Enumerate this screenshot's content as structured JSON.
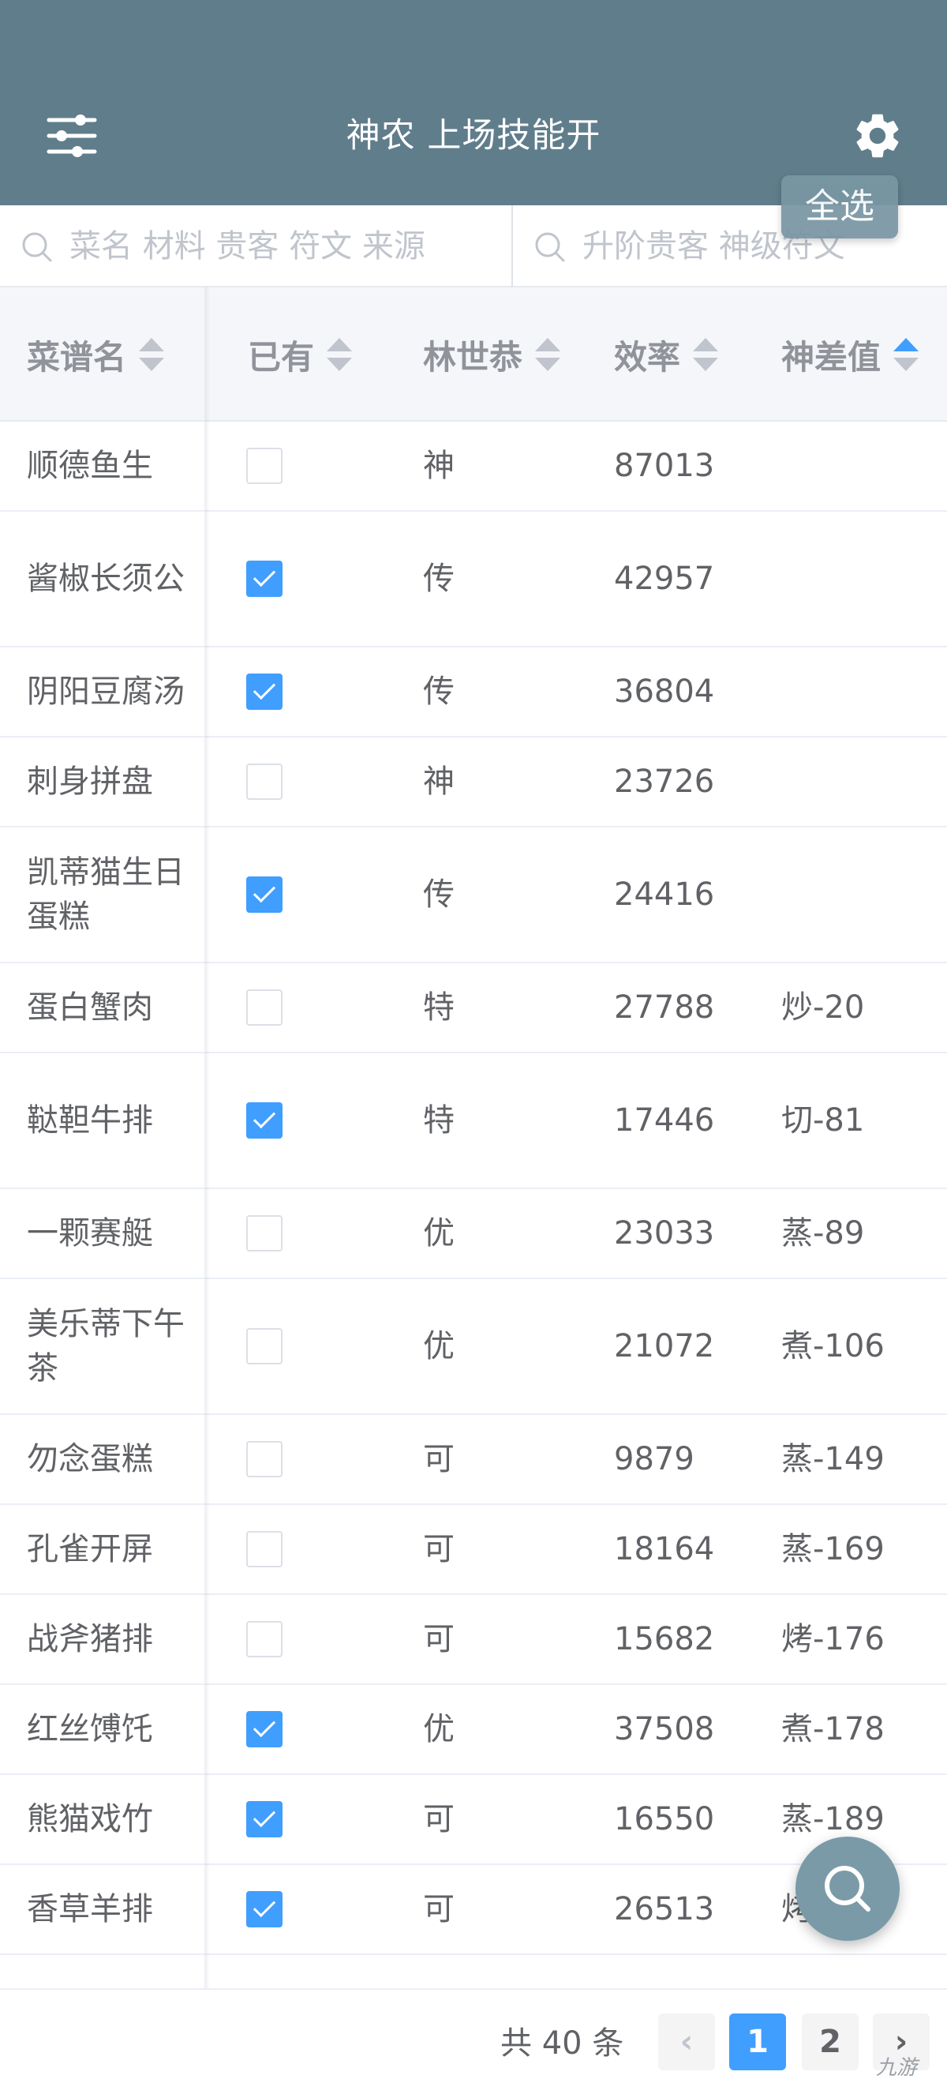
{
  "header": {
    "title": "神农 上场技能开",
    "select_all_label": "全选"
  },
  "search": {
    "left_placeholder": "菜名 材料 贵客 符文 来源",
    "right_placeholder": "升阶贵客 神级符文"
  },
  "table": {
    "columns": [
      {
        "label": "菜谱名",
        "sort": "none"
      },
      {
        "label": "已有",
        "sort": "none"
      },
      {
        "label": "林世恭",
        "sort": "none"
      },
      {
        "label": "效率",
        "sort": "none"
      },
      {
        "label": "神差值",
        "sort": "ascending"
      }
    ],
    "rows": [
      {
        "name": "顺德鱼生",
        "owned": false,
        "grade": "神",
        "efficiency": "87013",
        "diff": ""
      },
      {
        "name": "酱椒长须公",
        "owned": true,
        "grade": "传",
        "efficiency": "42957",
        "diff": ""
      },
      {
        "name": "阴阳豆腐汤",
        "owned": true,
        "grade": "传",
        "efficiency": "36804",
        "diff": ""
      },
      {
        "name": "刺身拼盘",
        "owned": false,
        "grade": "神",
        "efficiency": "23726",
        "diff": ""
      },
      {
        "name": "凯蒂猫生日蛋糕",
        "owned": true,
        "grade": "传",
        "efficiency": "24416",
        "diff": ""
      },
      {
        "name": "蛋白蟹肉",
        "owned": false,
        "grade": "特",
        "efficiency": "27788",
        "diff": "炒-20"
      },
      {
        "name": "鞑靼牛排",
        "owned": true,
        "grade": "特",
        "efficiency": "17446",
        "diff": "切-81"
      },
      {
        "name": "一颗赛艇",
        "owned": false,
        "grade": "优",
        "efficiency": "23033",
        "diff": "蒸-89"
      },
      {
        "name": "美乐蒂下午茶",
        "owned": false,
        "grade": "优",
        "efficiency": "21072",
        "diff": "煮-106"
      },
      {
        "name": "勿念蛋糕",
        "owned": false,
        "grade": "可",
        "efficiency": "9879",
        "diff": "蒸-149"
      },
      {
        "name": "孔雀开屏",
        "owned": false,
        "grade": "可",
        "efficiency": "18164",
        "diff": "蒸-169"
      },
      {
        "name": "战斧猪排",
        "owned": false,
        "grade": "可",
        "efficiency": "15682",
        "diff": "烤-176"
      },
      {
        "name": "红丝馎饦",
        "owned": true,
        "grade": "优",
        "efficiency": "37508",
        "diff": "煮-178"
      },
      {
        "name": "熊猫戏竹",
        "owned": true,
        "grade": "可",
        "efficiency": "16550",
        "diff": "蒸-189"
      },
      {
        "name": "香草羊排",
        "owned": true,
        "grade": "可",
        "efficiency": "26513",
        "diff": "烤"
      }
    ]
  },
  "pagination": {
    "total_label": "共 40 条",
    "pages": [
      "1",
      "2"
    ],
    "current_page": 1,
    "prev_glyph": "‹",
    "next_glyph": "›"
  },
  "watermark": "九游",
  "icons": {
    "menu": "sliders-icon",
    "settings": "gear-icon",
    "search": "search-icon"
  },
  "colors": {
    "header_bg": "#607d8b",
    "primary": "#409eff",
    "fab_bg": "#7a9aa8"
  }
}
